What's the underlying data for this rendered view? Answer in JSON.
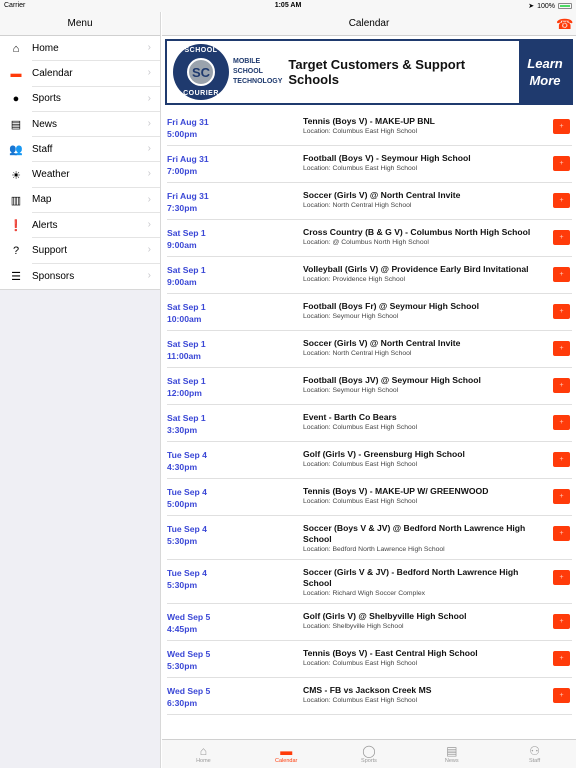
{
  "status_bar": {
    "carrier": "Carrier",
    "time": "1:05 AM",
    "battery": "100%"
  },
  "sidebar": {
    "title": "Menu",
    "items": [
      {
        "label": "Home",
        "icon": "home-icon",
        "glyph": "⌂"
      },
      {
        "label": "Calendar",
        "icon": "calendar-icon",
        "glyph": "▬"
      },
      {
        "label": "Sports",
        "icon": "ball-icon",
        "glyph": "●"
      },
      {
        "label": "News",
        "icon": "newspaper-icon",
        "glyph": "▤"
      },
      {
        "label": "Staff",
        "icon": "staff-icon",
        "glyph": "👥"
      },
      {
        "label": "Weather",
        "icon": "sun-icon",
        "glyph": "☀"
      },
      {
        "label": "Map",
        "icon": "map-icon",
        "glyph": "▥"
      },
      {
        "label": "Alerts",
        "icon": "alert-icon",
        "glyph": "❗"
      },
      {
        "label": "Support",
        "icon": "help-icon",
        "glyph": "?"
      },
      {
        "label": "Sponsors",
        "icon": "list-icon",
        "glyph": "☰"
      }
    ]
  },
  "header": {
    "title": "Calendar",
    "phone_icon": "☎"
  },
  "banner": {
    "logo_top": "SCHOOL",
    "logo_center": "SC",
    "logo_bottom": "COURIER",
    "tagline": [
      "MOBILE",
      "SCHOOL",
      "TECHNOLOGY"
    ],
    "headline": "Target Customers & Support Schools",
    "cta_line1": "Learn",
    "cta_line2": "More"
  },
  "events": [
    {
      "date": "Fri Aug 31",
      "time": "5:00pm",
      "title": "Tennis (Boys V) - MAKE-UP BNL",
      "location": "Location: Columbus East High School"
    },
    {
      "date": "Fri Aug 31",
      "time": "7:00pm",
      "title": "Football (Boys V) - Seymour High School",
      "location": "Location: Columbus East High School"
    },
    {
      "date": "Fri Aug 31",
      "time": "7:30pm",
      "title": "Soccer (Girls V) @ North Central Invite",
      "location": "Location: North Central High School"
    },
    {
      "date": "Sat Sep 1",
      "time": "9:00am",
      "title": "Cross Country (B & G V) - Columbus North High School",
      "location": "Location: @ Columbus North High School"
    },
    {
      "date": "Sat Sep 1",
      "time": "9:00am",
      "title": "Volleyball (Girls V) @ Providence Early Bird Invitational",
      "location": "Location: Providence High School"
    },
    {
      "date": "Sat Sep 1",
      "time": "10:00am",
      "title": "Football (Boys Fr) @ Seymour High School",
      "location": "Location: Seymour High School"
    },
    {
      "date": "Sat Sep 1",
      "time": "11:00am",
      "title": "Soccer (Girls V) @ North Central Invite",
      "location": "Location: North Central High School"
    },
    {
      "date": "Sat Sep 1",
      "time": "12:00pm",
      "title": "Football (Boys JV) @ Seymour High School",
      "location": "Location: Seymour High School"
    },
    {
      "date": "Sat Sep 1",
      "time": "3:30pm",
      "title": "Event - Barth Co Bears",
      "location": "Location: Columbus East High School"
    },
    {
      "date": "Tue Sep 4",
      "time": "4:30pm",
      "title": "Golf (Girls V) - Greensburg High School",
      "location": "Location: Columbus East High School"
    },
    {
      "date": "Tue Sep 4",
      "time": "5:00pm",
      "title": "Tennis (Boys V) - MAKE-UP W/ GREENWOOD",
      "location": "Location: Columbus East High School"
    },
    {
      "date": "Tue Sep 4",
      "time": "5:30pm",
      "title": "Soccer (Boys V & JV) @ Bedford North Lawrence High School",
      "location": "Location: Bedford North Lawrence High School"
    },
    {
      "date": "Tue Sep 4",
      "time": "5:30pm",
      "title": "Soccer (Girls V & JV) - Bedford North Lawrence High School",
      "location": "Location: Richard Wigh Soccer Complex"
    },
    {
      "date": "Wed Sep 5",
      "time": "4:45pm",
      "title": "Golf (Girls V) @ Shelbyville High School",
      "location": "Location: Shelbyville High School"
    },
    {
      "date": "Wed Sep 5",
      "time": "5:30pm",
      "title": "Tennis (Boys V) - East Central High School",
      "location": "Location: Columbus East High School"
    },
    {
      "date": "Wed Sep 5",
      "time": "6:30pm",
      "title": "CMS - FB vs Jackson Creek MS",
      "location": "Location: Columbus East High School"
    }
  ],
  "add_button_label": "+",
  "tabbar": {
    "active": "Calendar",
    "tabs": [
      {
        "label": "Home",
        "icon": "home-icon",
        "glyph": "⌂"
      },
      {
        "label": "Calendar",
        "icon": "calendar-icon",
        "glyph": "▬"
      },
      {
        "label": "Sports",
        "icon": "ball-icon",
        "glyph": "◯"
      },
      {
        "label": "News",
        "icon": "newspaper-icon",
        "glyph": "▤"
      },
      {
        "label": "Staff",
        "icon": "staff-icon",
        "glyph": "⚇"
      }
    ]
  },
  "colors": {
    "accent": "#ff3b0a",
    "date_blue": "#3a47d6",
    "banner_navy": "#1f3a6e"
  }
}
